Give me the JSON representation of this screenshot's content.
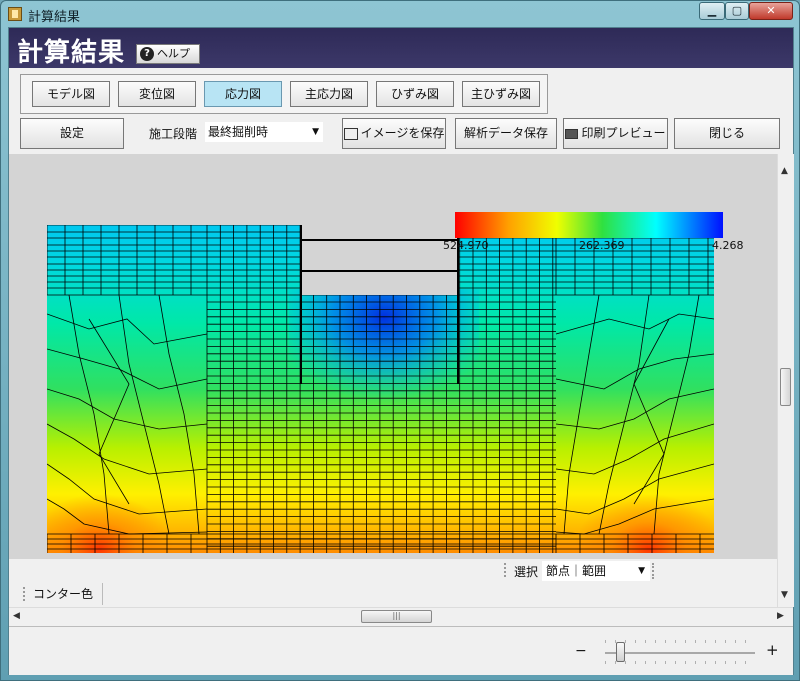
{
  "window": {
    "title": "計算結果"
  },
  "header": {
    "title": "計算結果",
    "help_label": "ヘルプ"
  },
  "tabs": [
    {
      "label": "モデル図",
      "active": false
    },
    {
      "label": "変位図",
      "active": false
    },
    {
      "label": "応力図",
      "active": true
    },
    {
      "label": "主応力図",
      "active": false
    },
    {
      "label": "ひずみ図",
      "active": false
    },
    {
      "label": "主ひずみ図",
      "active": false
    }
  ],
  "toolbar": {
    "settings_label": "設定",
    "stage_label": "施工段階",
    "stage_value": "最終掘削時",
    "save_image_label": "イメージを保存",
    "save_data_label": "解析データ保存",
    "print_preview_label": "印刷プレビュー",
    "close_label": "閉じる"
  },
  "legend": {
    "max": "524.970",
    "mid": "262.369",
    "min": "4.268"
  },
  "selection": {
    "label": "選択",
    "value": "節点｜範囲"
  },
  "contour_tab": {
    "label": "コンター色"
  },
  "zoom": {
    "minus": "−",
    "plus": "+",
    "level": 0.1
  },
  "colors": {
    "header_bg": "#3c3869",
    "active_tab": "#b8e4f4"
  }
}
